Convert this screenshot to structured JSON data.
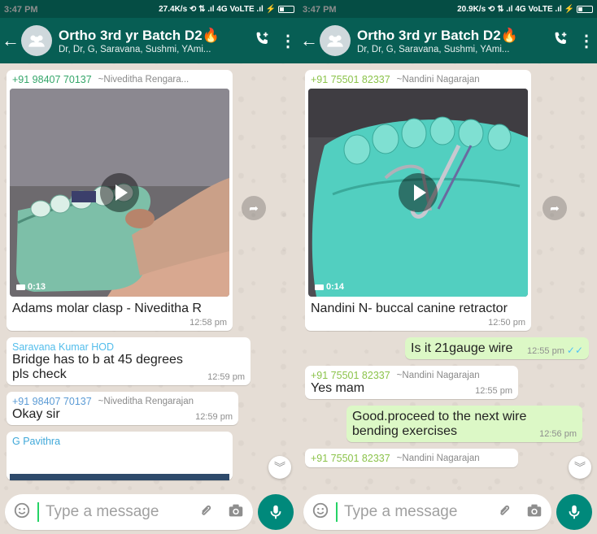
{
  "left": {
    "status": {
      "time": "3:47 PM",
      "indicators": "27.4K/s ⟲ ⇅ .ıl 4G VoLTE .ıl ⚡"
    },
    "header": {
      "title": "Ortho 3rd yr Batch D2🔥",
      "subtitle": "Dr, Dr, G, Saravana, Sushmi, YAmi..."
    },
    "messages": [
      {
        "number": "+91 98407 70137",
        "name": "~Niveditha Rengara...",
        "duration": "0:13",
        "caption": "Adams molar clasp - Niveditha R",
        "time": "12:58 pm"
      },
      {
        "number": "Saravana Kumar HOD",
        "text": "Bridge has to b at 45 degrees pls check",
        "time": "12:59 pm"
      },
      {
        "number": "+91 98407 70137",
        "name": "~Niveditha Rengarajan",
        "text": "Okay sir",
        "time": "12:59 pm"
      },
      {
        "number": "G Pavithra"
      }
    ],
    "input": {
      "placeholder": "Type a message"
    }
  },
  "right": {
    "status": {
      "time": "3:47 PM",
      "indicators": "20.9K/s ⟲ ⇅ .ıl 4G VoLTE .ıl ⚡"
    },
    "header": {
      "title": "Ortho 3rd yr Batch D2🔥",
      "subtitle": "Dr, Dr, G, Saravana, Sushmi, YAmi..."
    },
    "messages": [
      {
        "number": "+91 75501 82337",
        "name": "~Nandini Nagarajan",
        "duration": "0:14",
        "caption": "Nandini N- buccal canine retractor",
        "time": "12:50 pm"
      },
      {
        "text": "Is it 21gauge wire",
        "time": "12:55 pm"
      },
      {
        "number": "+91 75501 82337",
        "name": "~Nandini Nagarajan",
        "text": "Yes mam",
        "time": "12:55 pm"
      },
      {
        "text": "Good.proceed to the next wire bending exercises",
        "time": "12:56 pm"
      },
      {
        "number": "+91 75501 82337",
        "name": "~Nandini Nagarajan"
      }
    ],
    "input": {
      "placeholder": "Type a message"
    }
  },
  "colors": {
    "header": "#075e54",
    "statusbar": "#054d44",
    "outgoing": "#dcf8c6",
    "accent": "#00897b",
    "read_tick": "#4fc3f7"
  },
  "icons": [
    "back-arrow-icon",
    "group-avatar-icon",
    "add-call-icon",
    "more-vert-icon",
    "play-icon",
    "video-camera-icon",
    "forward-icon",
    "scroll-down-icon",
    "emoji-icon",
    "attach-icon",
    "camera-icon",
    "mic-icon",
    "double-tick-icon"
  ]
}
